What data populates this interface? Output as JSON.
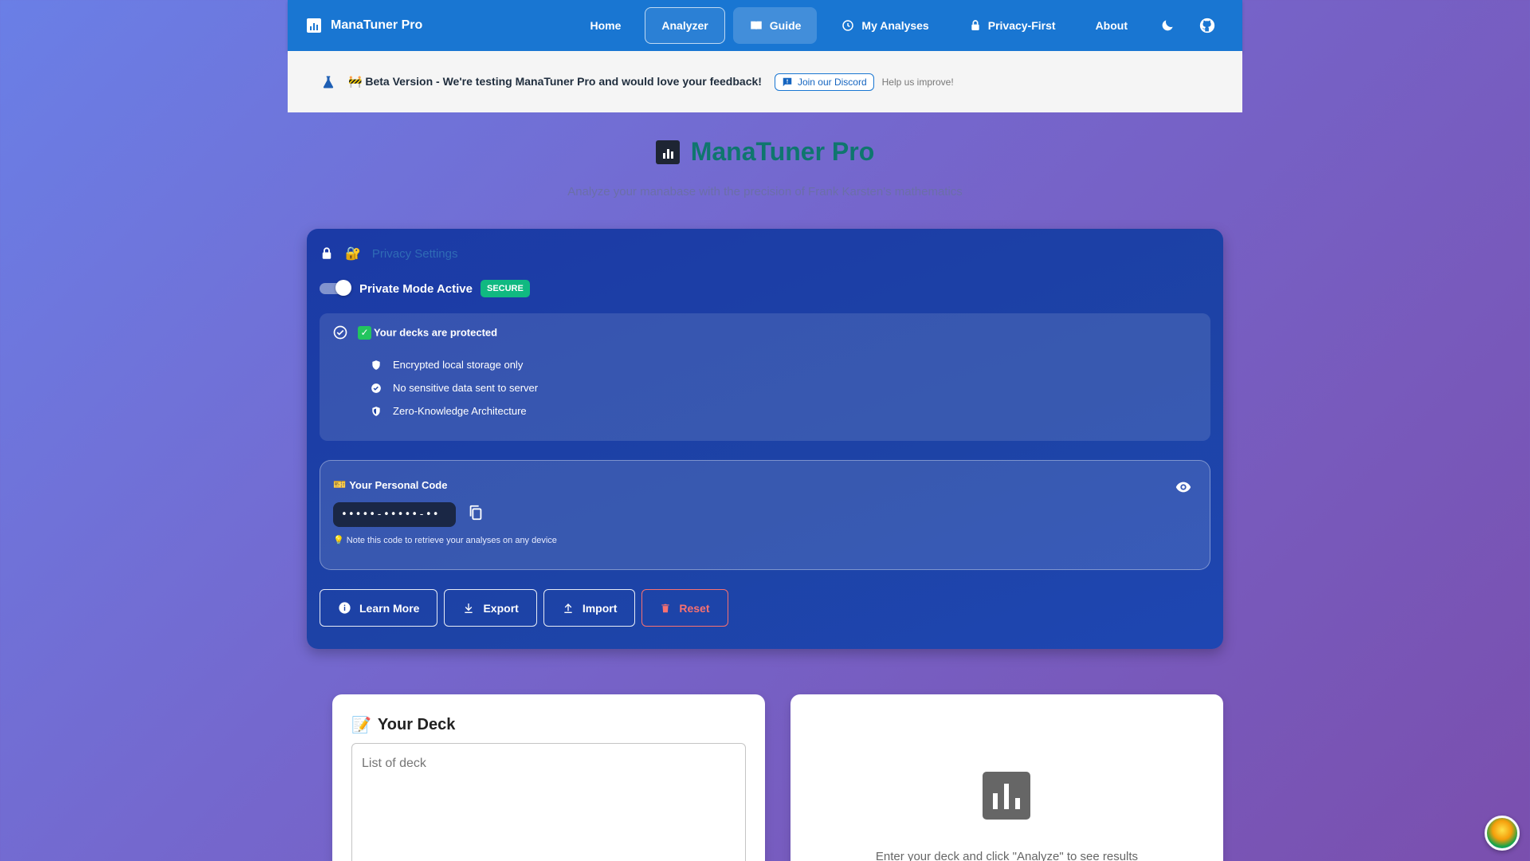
{
  "nav": {
    "brand": "ManaTuner Pro",
    "items": [
      "Home",
      "Analyzer",
      "Guide",
      "My Analyses",
      "Privacy-First",
      "About"
    ]
  },
  "beta": {
    "label": "Beta Version",
    "message": " - We're testing ManaTuner Pro and would love your feedback!",
    "discord": "Join our Discord",
    "help": "Help us improve!"
  },
  "hero": {
    "title": "ManaTuner Pro",
    "subtitle": "Analyze your manabase with the precision of Frank Karsten's mathematics"
  },
  "privacy": {
    "title": "Privacy Settings",
    "mode_label": "Private Mode Active",
    "badge": "SECURE",
    "protected_title": "Your decks are protected",
    "features": [
      "Encrypted local storage only",
      "No sensitive data sent to server",
      "Zero-Knowledge Architecture"
    ],
    "code_title": "Your Personal Code",
    "code_value": "•••••-•••••-••",
    "code_hint": "Note this code to retrieve your analyses on any device",
    "buttons": {
      "learn": "Learn More",
      "export": "Export",
      "import": "Import",
      "reset": "Reset"
    }
  },
  "deck": {
    "title": "Your Deck",
    "placeholder": "List of deck"
  },
  "results": {
    "empty": "Enter your deck and click \"Analyze\" to see results"
  },
  "colors": {
    "nav": "#1976d2",
    "accent": "#0f766e",
    "secure": "#10b981",
    "reset": "#f87171"
  }
}
